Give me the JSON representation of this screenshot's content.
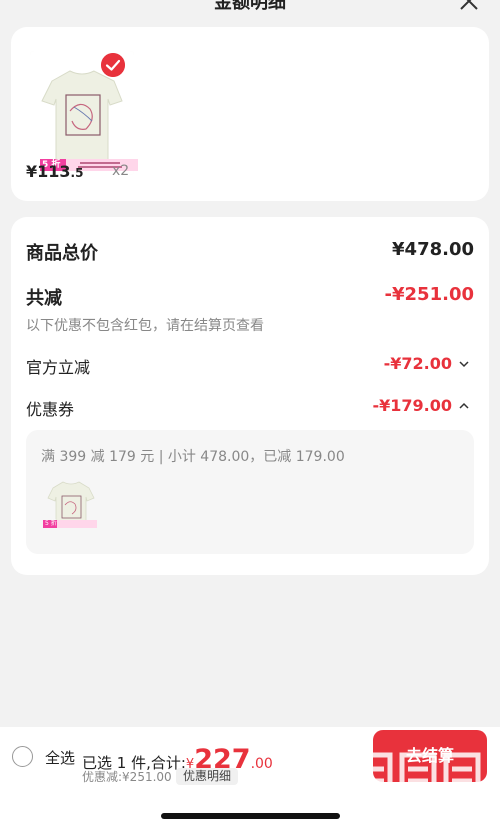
{
  "header": {
    "title": "金额明细",
    "close_icon": "close-icon"
  },
  "item": {
    "image_icon": "tshirt-product-image",
    "checked_icon": "checkmark-icon",
    "discount_tag": "5 折",
    "price_main": "¥113",
    "price_cents": ".5",
    "qty": "x2"
  },
  "summary": {
    "total_label": "商品总价",
    "total_value": "¥478.00",
    "reduce_label": "共减",
    "reduce_value": "-¥251.00",
    "note": "以下优惠不包含红包，请在结算页查看",
    "official_label": "官方立减",
    "official_value": "-¥72.00",
    "coupon_label": "优惠券",
    "coupon_value": "-¥179.00",
    "coupon_detail": "满 399 减 179 元 | 小计 478.00，已减 179.00",
    "coupon_thumb_tag": "5 折"
  },
  "bottom": {
    "select_all": "全选",
    "selected_prefix": "已选 1 件,合计:",
    "currency": "¥",
    "amount": "227",
    "amount_cents": ".00",
    "discount_text": "优惠减:¥251.00",
    "detail_button": "优惠明细",
    "checkout_label": "去结算",
    "watermark_text": "zhizhizhi.com"
  },
  "colors": {
    "accent": "#e8323c",
    "background": "#f2f2f2",
    "card": "#ffffff"
  }
}
